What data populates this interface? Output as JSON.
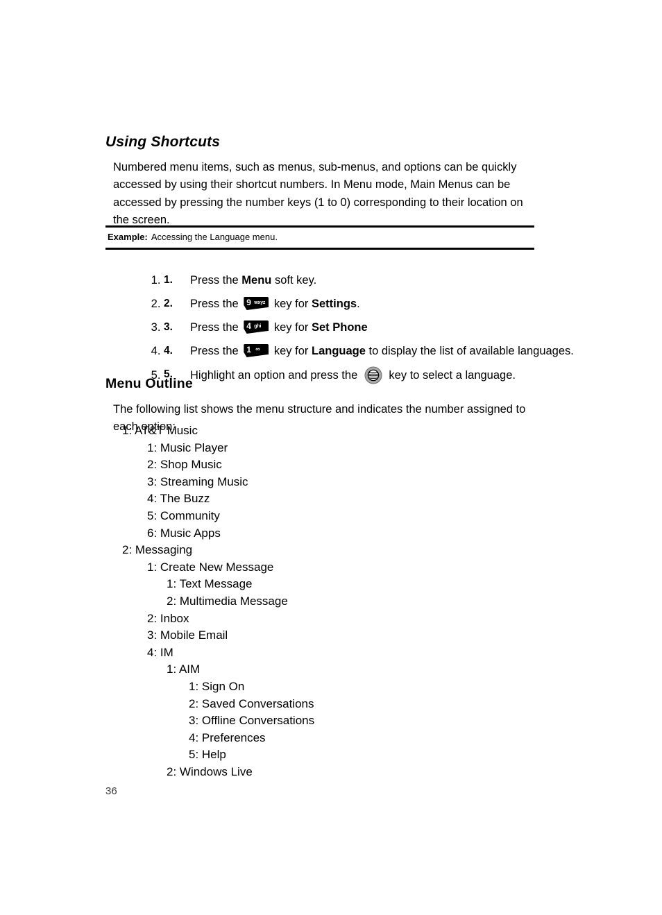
{
  "page": {
    "number": "36"
  },
  "shortcuts": {
    "heading": "Using Shortcuts",
    "paragraph": "Numbered menu items, such as menus, sub-menus, and options can be quickly accessed by using their shortcut numbers. In Menu mode, Main Menus can be accessed by pressing the number keys (1 to 0) corresponding to their location on the screen."
  },
  "example": {
    "label": "Example:",
    "text": "Accessing the Language menu."
  },
  "steps": [
    {
      "num": "1.",
      "pre": "Press the ",
      "bold": "Menu",
      "post": " soft key.",
      "key": null
    },
    {
      "num": "2.",
      "pre": "Press the ",
      "key": {
        "type": "keycap",
        "digit": "9",
        "letters": "wxyz",
        "name": "key-9-wxyz"
      },
      "mid": " key for ",
      "bold": "Settings",
      "post": "."
    },
    {
      "num": "3.",
      "pre": "Press the ",
      "key": {
        "type": "keycap",
        "digit": "4",
        "letters": "ghi",
        "name": "key-4-ghi"
      },
      "mid": " key for ",
      "bold": "Set Phone",
      "post": ""
    },
    {
      "num": "4.",
      "pre": "Press the ",
      "key": {
        "type": "keycap",
        "digit": "1",
        "letters": "∞",
        "name": "key-1-voicemail"
      },
      "mid": " key for ",
      "bold": "Language",
      "post": " to display the list of available languages."
    },
    {
      "num": "5.",
      "pre": "Highlight an option and press the ",
      "key": {
        "type": "globe",
        "name": "att-globe-select-key"
      },
      "mid": " key to select a language.",
      "bold": "",
      "post": ""
    }
  ],
  "outline": {
    "heading": "Menu Outline",
    "intro": "The following list shows the menu structure and indicates the number assigned to each option:",
    "items": [
      {
        "level": 1,
        "text": "1: AT&T Music"
      },
      {
        "level": 2,
        "text": "1: Music Player"
      },
      {
        "level": 2,
        "text": "2: Shop Music"
      },
      {
        "level": 2,
        "text": "3: Streaming Music"
      },
      {
        "level": 2,
        "text": "4: The Buzz"
      },
      {
        "level": 2,
        "text": "5: Community"
      },
      {
        "level": 2,
        "text": "6: Music Apps"
      },
      {
        "level": 1,
        "text": "2: Messaging"
      },
      {
        "level": 2,
        "text": "1: Create New Message"
      },
      {
        "level": 3,
        "text": "1: Text Message"
      },
      {
        "level": 3,
        "text": "2: Multimedia Message"
      },
      {
        "level": 2,
        "text": "2: Inbox"
      },
      {
        "level": 2,
        "text": "3: Mobile Email"
      },
      {
        "level": 2,
        "text": "4: IM"
      },
      {
        "level": 3,
        "text": "1: AIM"
      },
      {
        "level": 4,
        "text": "1: Sign On"
      },
      {
        "level": 4,
        "text": "2: Saved Conversations"
      },
      {
        "level": 4,
        "text": "3: Offline Conversations"
      },
      {
        "level": 4,
        "text": "4: Preferences"
      },
      {
        "level": 4,
        "text": "5: Help"
      },
      {
        "level": 3,
        "text": "2: Windows Live"
      }
    ]
  },
  "colors": {
    "text": "#000000",
    "key_fill": "#000000",
    "key_label": "#ffffff",
    "globe_fill": "#a8a8a8",
    "page_number": "#3a3a3a"
  }
}
